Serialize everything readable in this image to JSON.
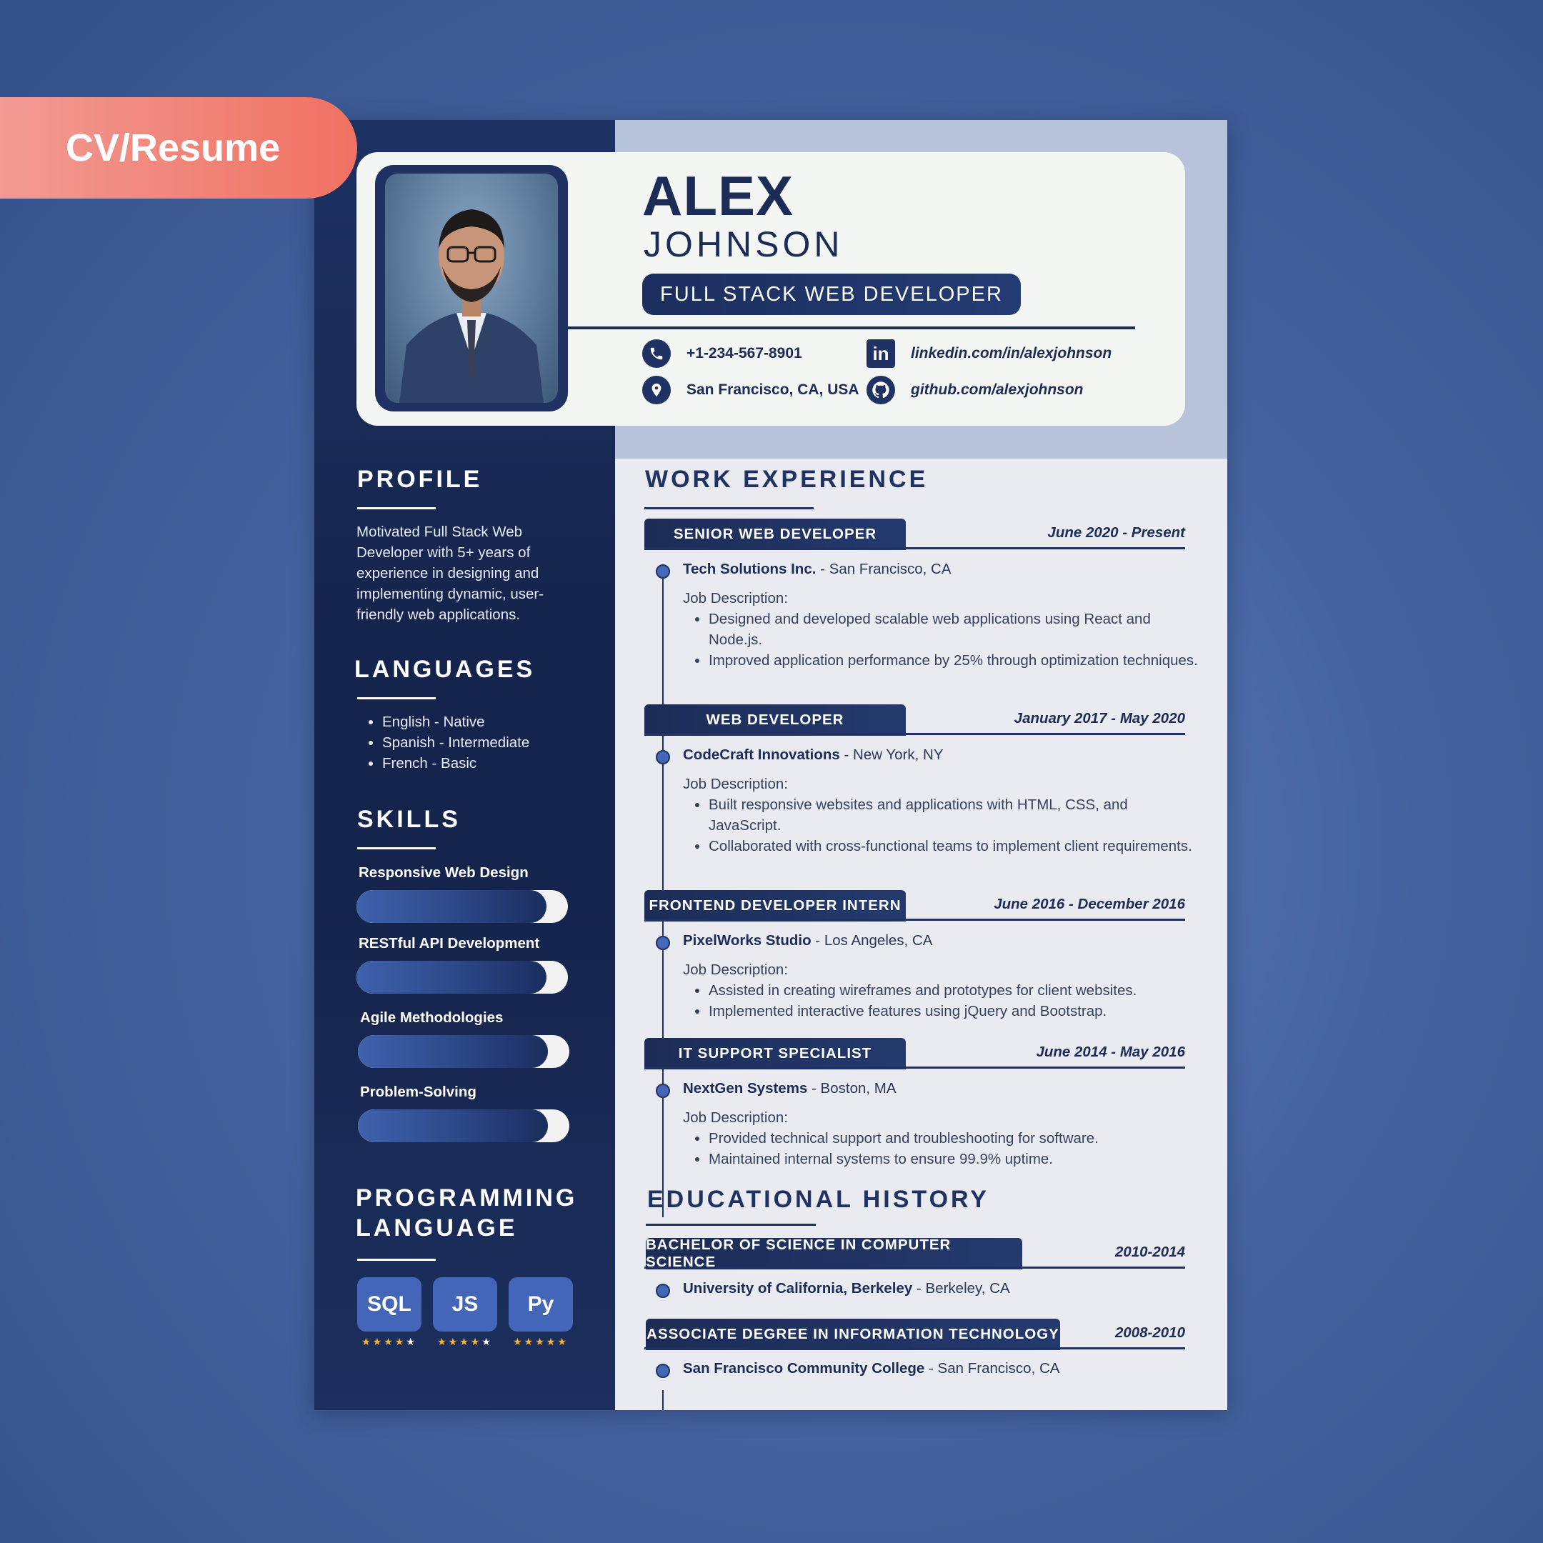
{
  "tag": "CV/Resume",
  "header": {
    "first_name": "ALEX",
    "last_name": "JOHNSON",
    "role": "FULL STACK WEB DEVELOPER",
    "phone": "+1-234-567-8901",
    "location": "San Francisco, CA, USA",
    "linkedin": "linkedin.com/in/alexjohnson",
    "github": "github.com/alexjohnson"
  },
  "profile": {
    "title": "PROFILE",
    "text": "Motivated Full Stack Web Developer with 5+ years of experience in designing and implementing dynamic, user-friendly web applications."
  },
  "languages": {
    "title": "LANGUAGES",
    "items": [
      "English - Native",
      "Spanish - Intermediate",
      "French - Basic"
    ]
  },
  "skills": {
    "title": "SKILLS",
    "items": [
      {
        "label": "Responsive Web Design",
        "level": 0.9
      },
      {
        "label": "RESTful API Development",
        "level": 0.9
      },
      {
        "label": "Agile Methodologies",
        "level": 0.9
      },
      {
        "label": "Problem-Solving",
        "level": 0.9
      }
    ]
  },
  "programming": {
    "title_line1": "PROGRAMMING",
    "title_line2": "LANGUAGE",
    "items": [
      {
        "label": "SQL",
        "rating": 4
      },
      {
        "label": "JS",
        "rating": 4
      },
      {
        "label": "Py",
        "rating": 5
      }
    ]
  },
  "work": {
    "title": "WORK EXPERIENCE",
    "jd_label": "Job Description:",
    "jobs": [
      {
        "title": "SENIOR WEB DEVELOPER",
        "date": "June 2020 - Present",
        "company": "Tech Solutions Inc.",
        "location": " - San Francisco, CA",
        "bullets": [
          "Designed and developed scalable web applications using React and Node.js.",
          "Improved application performance by 25% through optimization techniques."
        ]
      },
      {
        "title": "WEB DEVELOPER",
        "date": "January 2017 - May 2020",
        "company": "CodeCraft Innovations",
        "location": " - New York, NY",
        "bullets": [
          "Built responsive websites and applications with HTML, CSS, and JavaScript.",
          "Collaborated with cross-functional teams to implement client requirements."
        ]
      },
      {
        "title": "FRONTEND DEVELOPER INTERN",
        "date": "June 2016 - December 2016",
        "company": "PixelWorks Studio",
        "location": " - Los Angeles, CA",
        "bullets": [
          "Assisted in creating wireframes and prototypes for client websites.",
          "Implemented interactive features using jQuery and Bootstrap."
        ]
      },
      {
        "title": "IT SUPPORT SPECIALIST",
        "date": "June 2014 - May 2016",
        "company": "NextGen Systems",
        "location": " - Boston, MA",
        "bullets": [
          "Provided technical support and troubleshooting for software.",
          "Maintained internal systems to ensure 99.9% uptime."
        ]
      }
    ]
  },
  "education": {
    "title": "EDUCATIONAL HISTORY",
    "items": [
      {
        "degree": "BACHELOR OF SCIENCE IN COMPUTER SCIENCE",
        "date": "2010-2014",
        "school": "University of California, Berkeley",
        "location": " - Berkeley, CA"
      },
      {
        "degree": "ASSOCIATE DEGREE IN INFORMATION TECHNOLOGY",
        "date": "2008-2010",
        "school": "San Francisco Community College",
        "location": " - San Francisco, CA"
      }
    ]
  },
  "colors": {
    "navy": "#1c2c56",
    "accent_blue": "#4466b8",
    "tag_coral": "#ef7262",
    "star_gold": "#f4b43a"
  }
}
